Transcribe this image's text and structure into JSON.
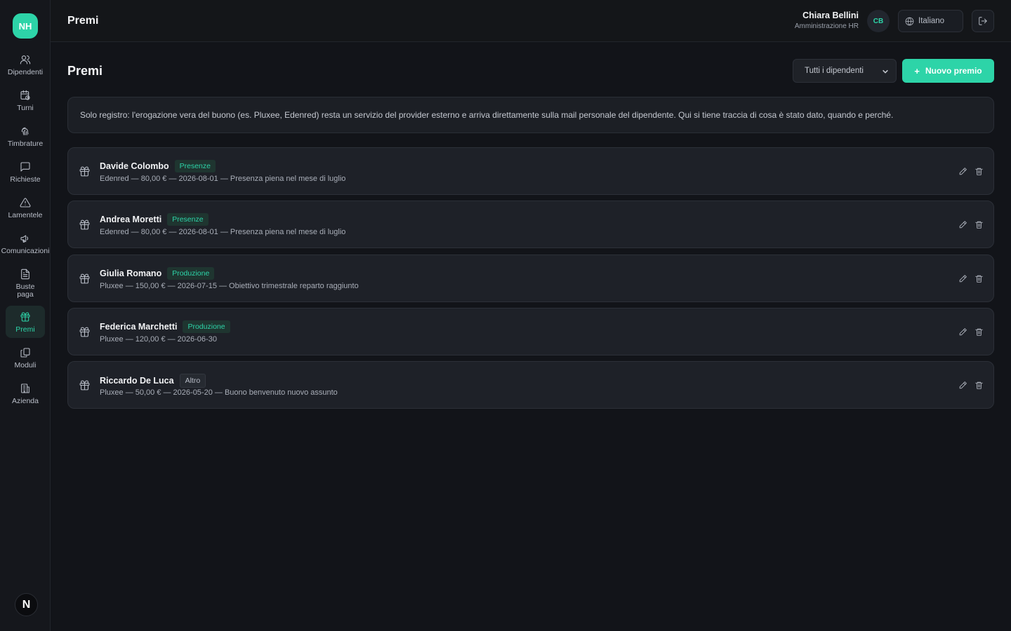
{
  "sidebar": {
    "logo": "NH",
    "items": [
      {
        "label": "Dipendenti",
        "icon": "users-icon"
      },
      {
        "label": "Turni",
        "icon": "calendar-clock-icon"
      },
      {
        "label": "Timbrature",
        "icon": "fingerprint-icon"
      },
      {
        "label": "Richieste",
        "icon": "message-square-icon"
      },
      {
        "label": "Lamentele",
        "icon": "alert-triangle-icon"
      },
      {
        "label": "Comunicazioni",
        "icon": "megaphone-icon"
      },
      {
        "label": "Buste\npaga",
        "icon": "file-text-icon"
      },
      {
        "label": "Premi",
        "icon": "gift-icon"
      },
      {
        "label": "Moduli",
        "icon": "copy-icon"
      },
      {
        "label": "Azienda",
        "icon": "building-icon"
      }
    ],
    "active": "Premi",
    "bottom_badge": "N"
  },
  "header": {
    "title": "Premi",
    "user_name": "Chiara Bellini",
    "user_role": "Amministrazione HR",
    "avatar_initials": "CB",
    "language": "Italiano"
  },
  "main": {
    "title": "Premi",
    "filter_value": "Tutti i dipendenti",
    "new_button": "Nuovo premio",
    "info_text": "Solo registro: l'erogazione vera del buono (es. Pluxee, Edenred) resta un servizio del provider esterno e arriva direttamente sulla mail personale del dipendente. Qui si tiene traccia di cosa è stato dato, quando e perché.",
    "rewards": [
      {
        "name": "Davide Colombo",
        "badge": "Presenze",
        "badge_style": "teal",
        "detail": "Edenred — 80,00 € — 2026-08-01 — Presenza piena nel mese di luglio"
      },
      {
        "name": "Andrea Moretti",
        "badge": "Presenze",
        "badge_style": "teal",
        "detail": "Edenred — 80,00 € — 2026-08-01 — Presenza piena nel mese di luglio"
      },
      {
        "name": "Giulia Romano",
        "badge": "Produzione",
        "badge_style": "teal",
        "detail": "Pluxee — 150,00 € — 2026-07-15 — Obiettivo trimestrale reparto raggiunto"
      },
      {
        "name": "Federica Marchetti",
        "badge": "Produzione",
        "badge_style": "teal",
        "detail": "Pluxee — 120,00 € — 2026-06-30"
      },
      {
        "name": "Riccardo De Luca",
        "badge": "Altro",
        "badge_style": "grey",
        "detail": "Pluxee — 50,00 € — 2026-05-20 — Buono benvenuto nuovo assunto"
      }
    ]
  },
  "colors": {
    "accent": "#2dd4a8",
    "background": "#121419",
    "card": "#1e2128"
  }
}
